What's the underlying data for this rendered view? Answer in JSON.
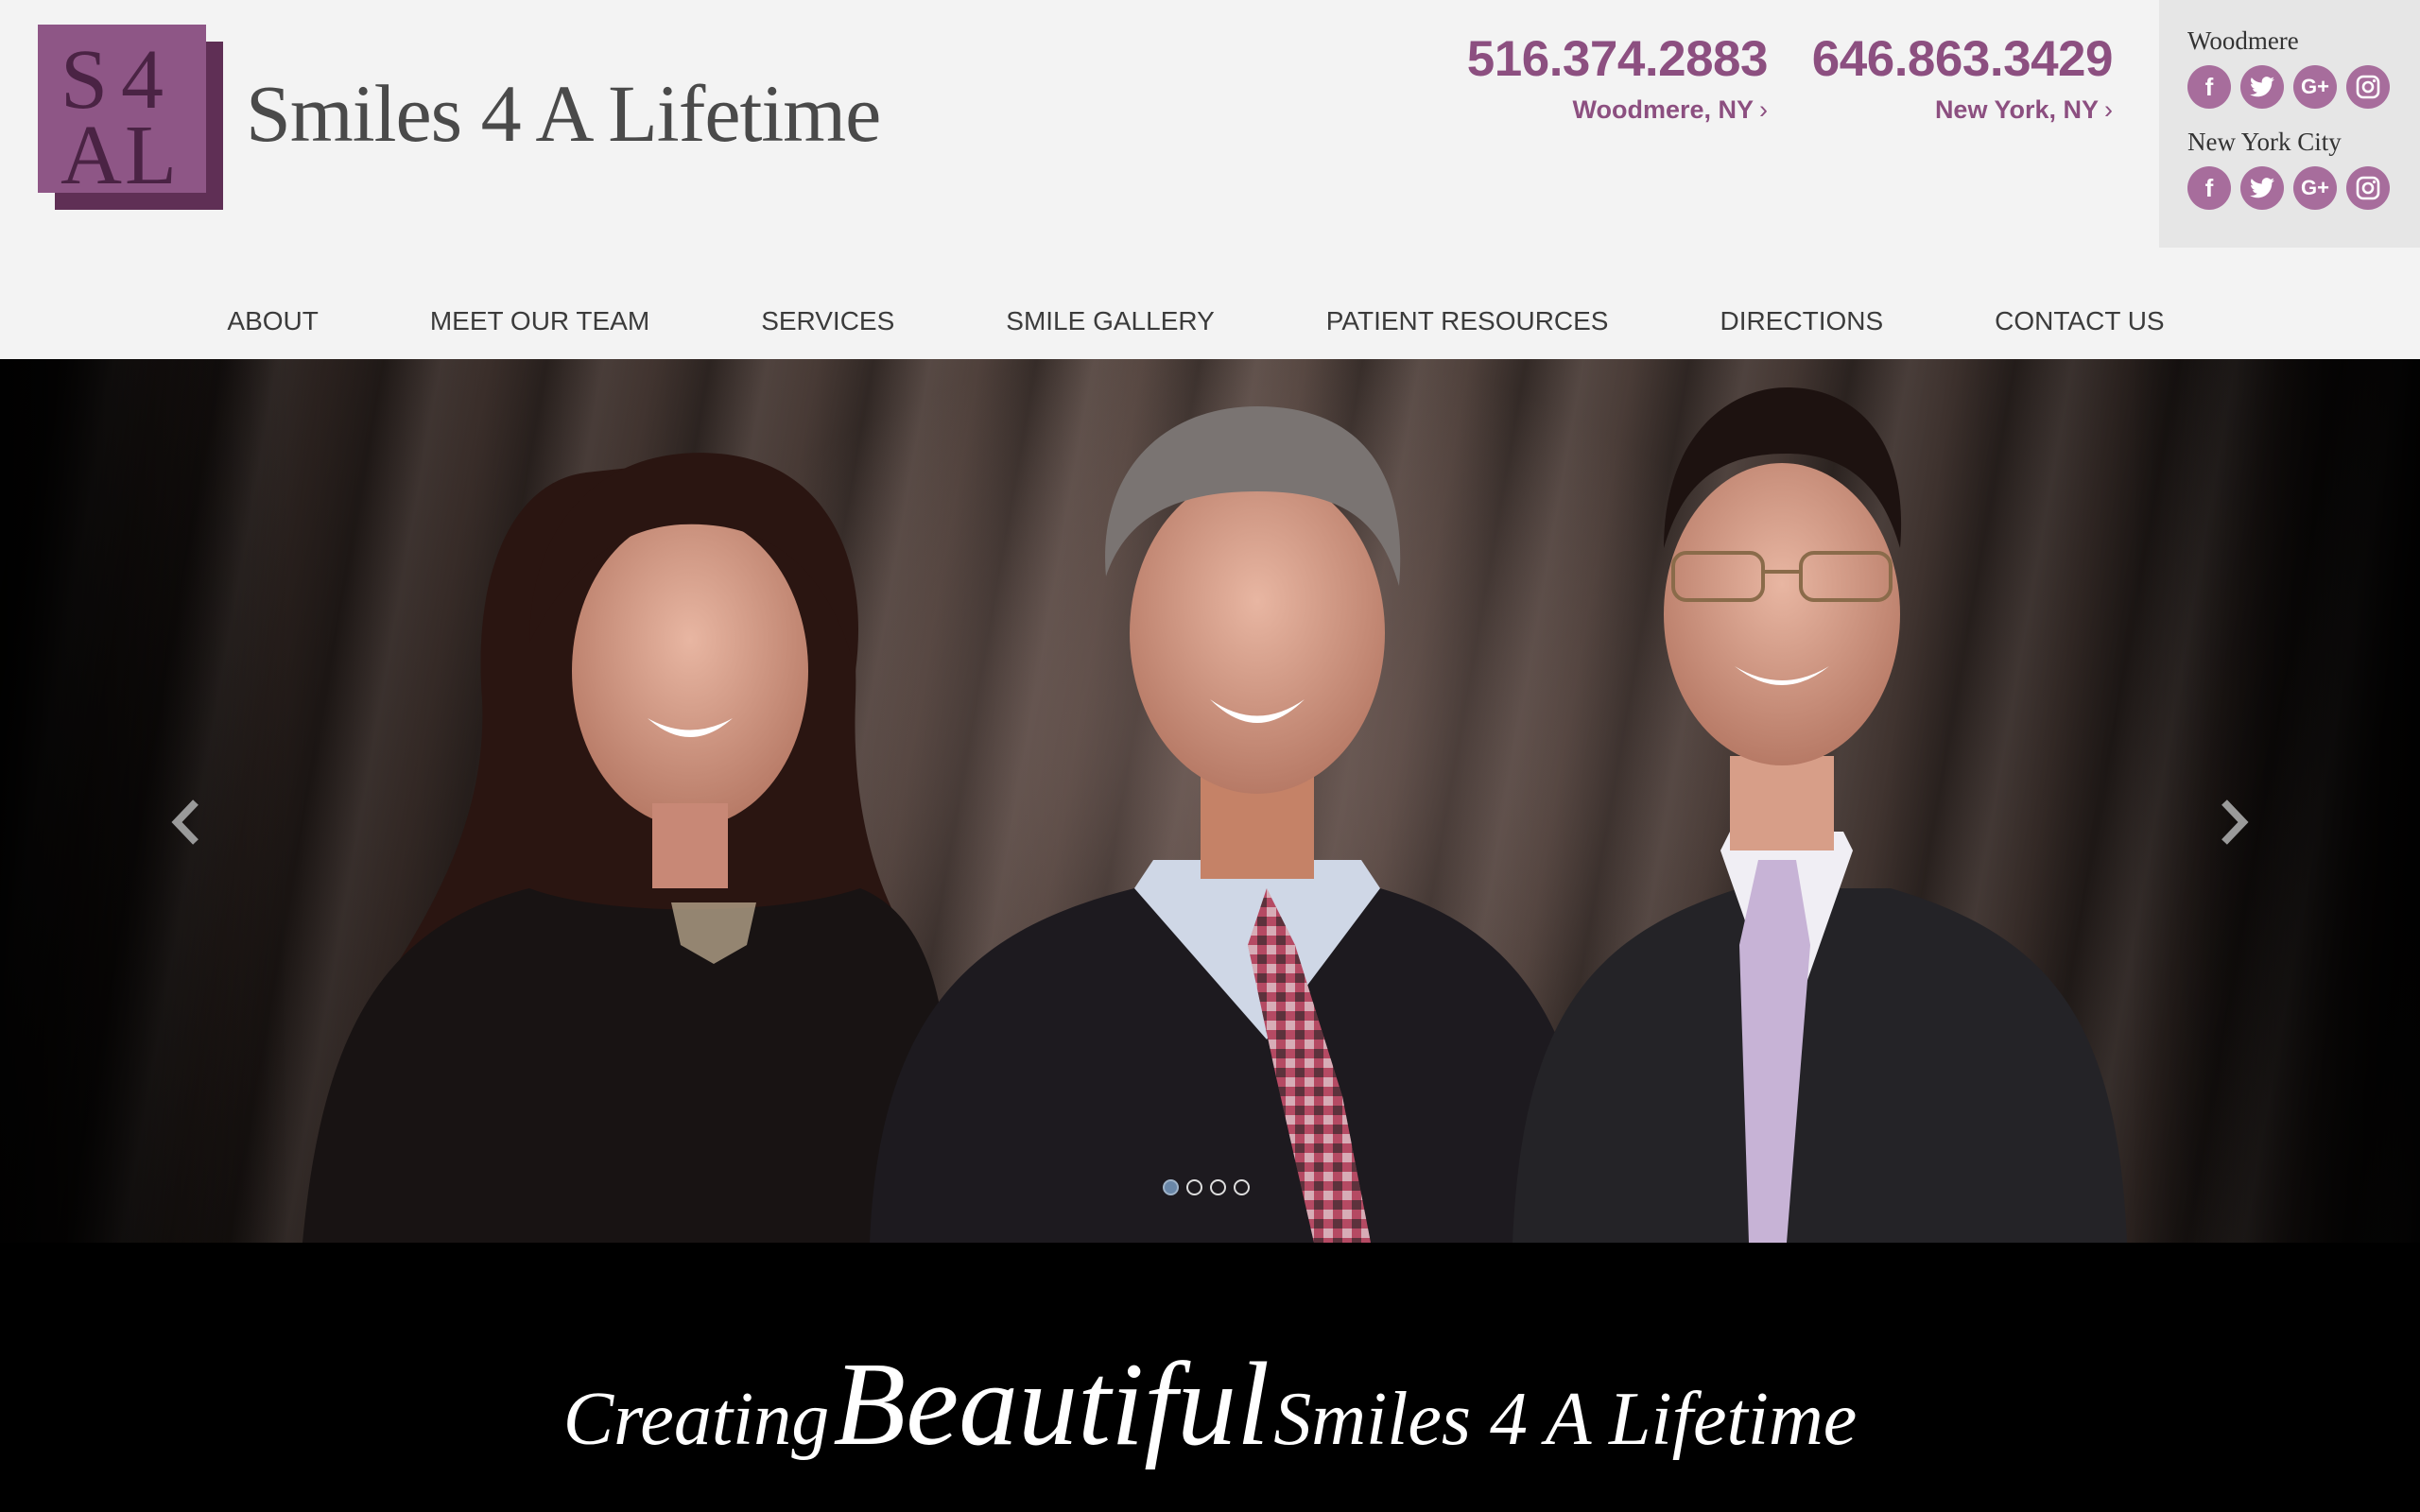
{
  "brand": {
    "logo_letters": "S4AL",
    "name": "Smiles 4 A Lifetime",
    "colors": {
      "primary": "#8c4f80",
      "logo_front": "#8e5686",
      "logo_back": "#5f2f55",
      "header_bg": "#f3f3f3"
    }
  },
  "phones": [
    {
      "number": "516.374.2883",
      "location": "Woodmere, NY"
    },
    {
      "number": "646.863.3429",
      "location": "New York, NY"
    }
  ],
  "social": [
    {
      "location": "Woodmere",
      "icons": [
        "facebook-icon",
        "twitter-icon",
        "google-plus-icon",
        "instagram-icon"
      ]
    },
    {
      "location": "New York City",
      "icons": [
        "facebook-icon",
        "twitter-icon",
        "google-plus-icon",
        "instagram-icon"
      ]
    }
  ],
  "nav": {
    "items": [
      "ABOUT",
      "MEET OUR TEAM",
      "SERVICES",
      "SMILE GALLERY",
      "PATIENT RESOURCES",
      "DIRECTIONS",
      "CONTACT US"
    ]
  },
  "hero": {
    "slides_total": 4,
    "active_slide": 1,
    "prev_icon": "chevron-left-icon",
    "next_icon": "chevron-right-icon"
  },
  "tagline": {
    "part1": "Creating",
    "part2": "Beautiful",
    "part3": "Smiles 4 A Lifetime"
  }
}
